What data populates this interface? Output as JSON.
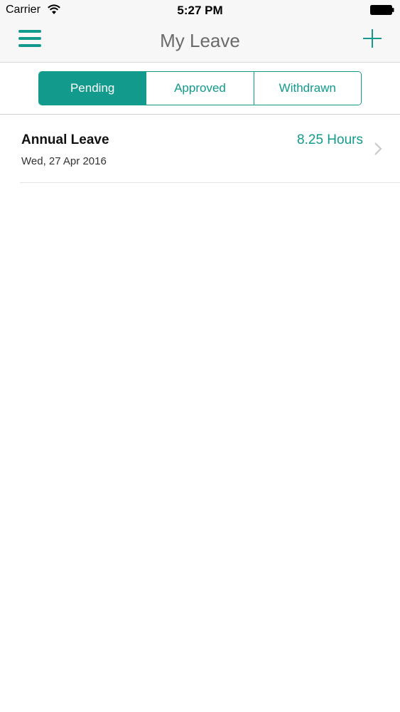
{
  "status_bar": {
    "carrier": "Carrier",
    "time": "5:27 PM"
  },
  "nav": {
    "title": "My Leave"
  },
  "tabs": [
    {
      "label": "Pending",
      "active": true
    },
    {
      "label": "Approved",
      "active": false
    },
    {
      "label": "Withdrawn",
      "active": false
    }
  ],
  "leave_items": [
    {
      "type": "Annual Leave",
      "date": "Wed, 27 Apr 2016",
      "hours": "8.25 Hours"
    }
  ],
  "colors": {
    "accent": "#129a8c",
    "title_gray": "#6b6b6b"
  },
  "icons": {
    "menu": "hamburger-menu-icon",
    "add": "plus-icon",
    "row": "chevron-right-icon"
  }
}
